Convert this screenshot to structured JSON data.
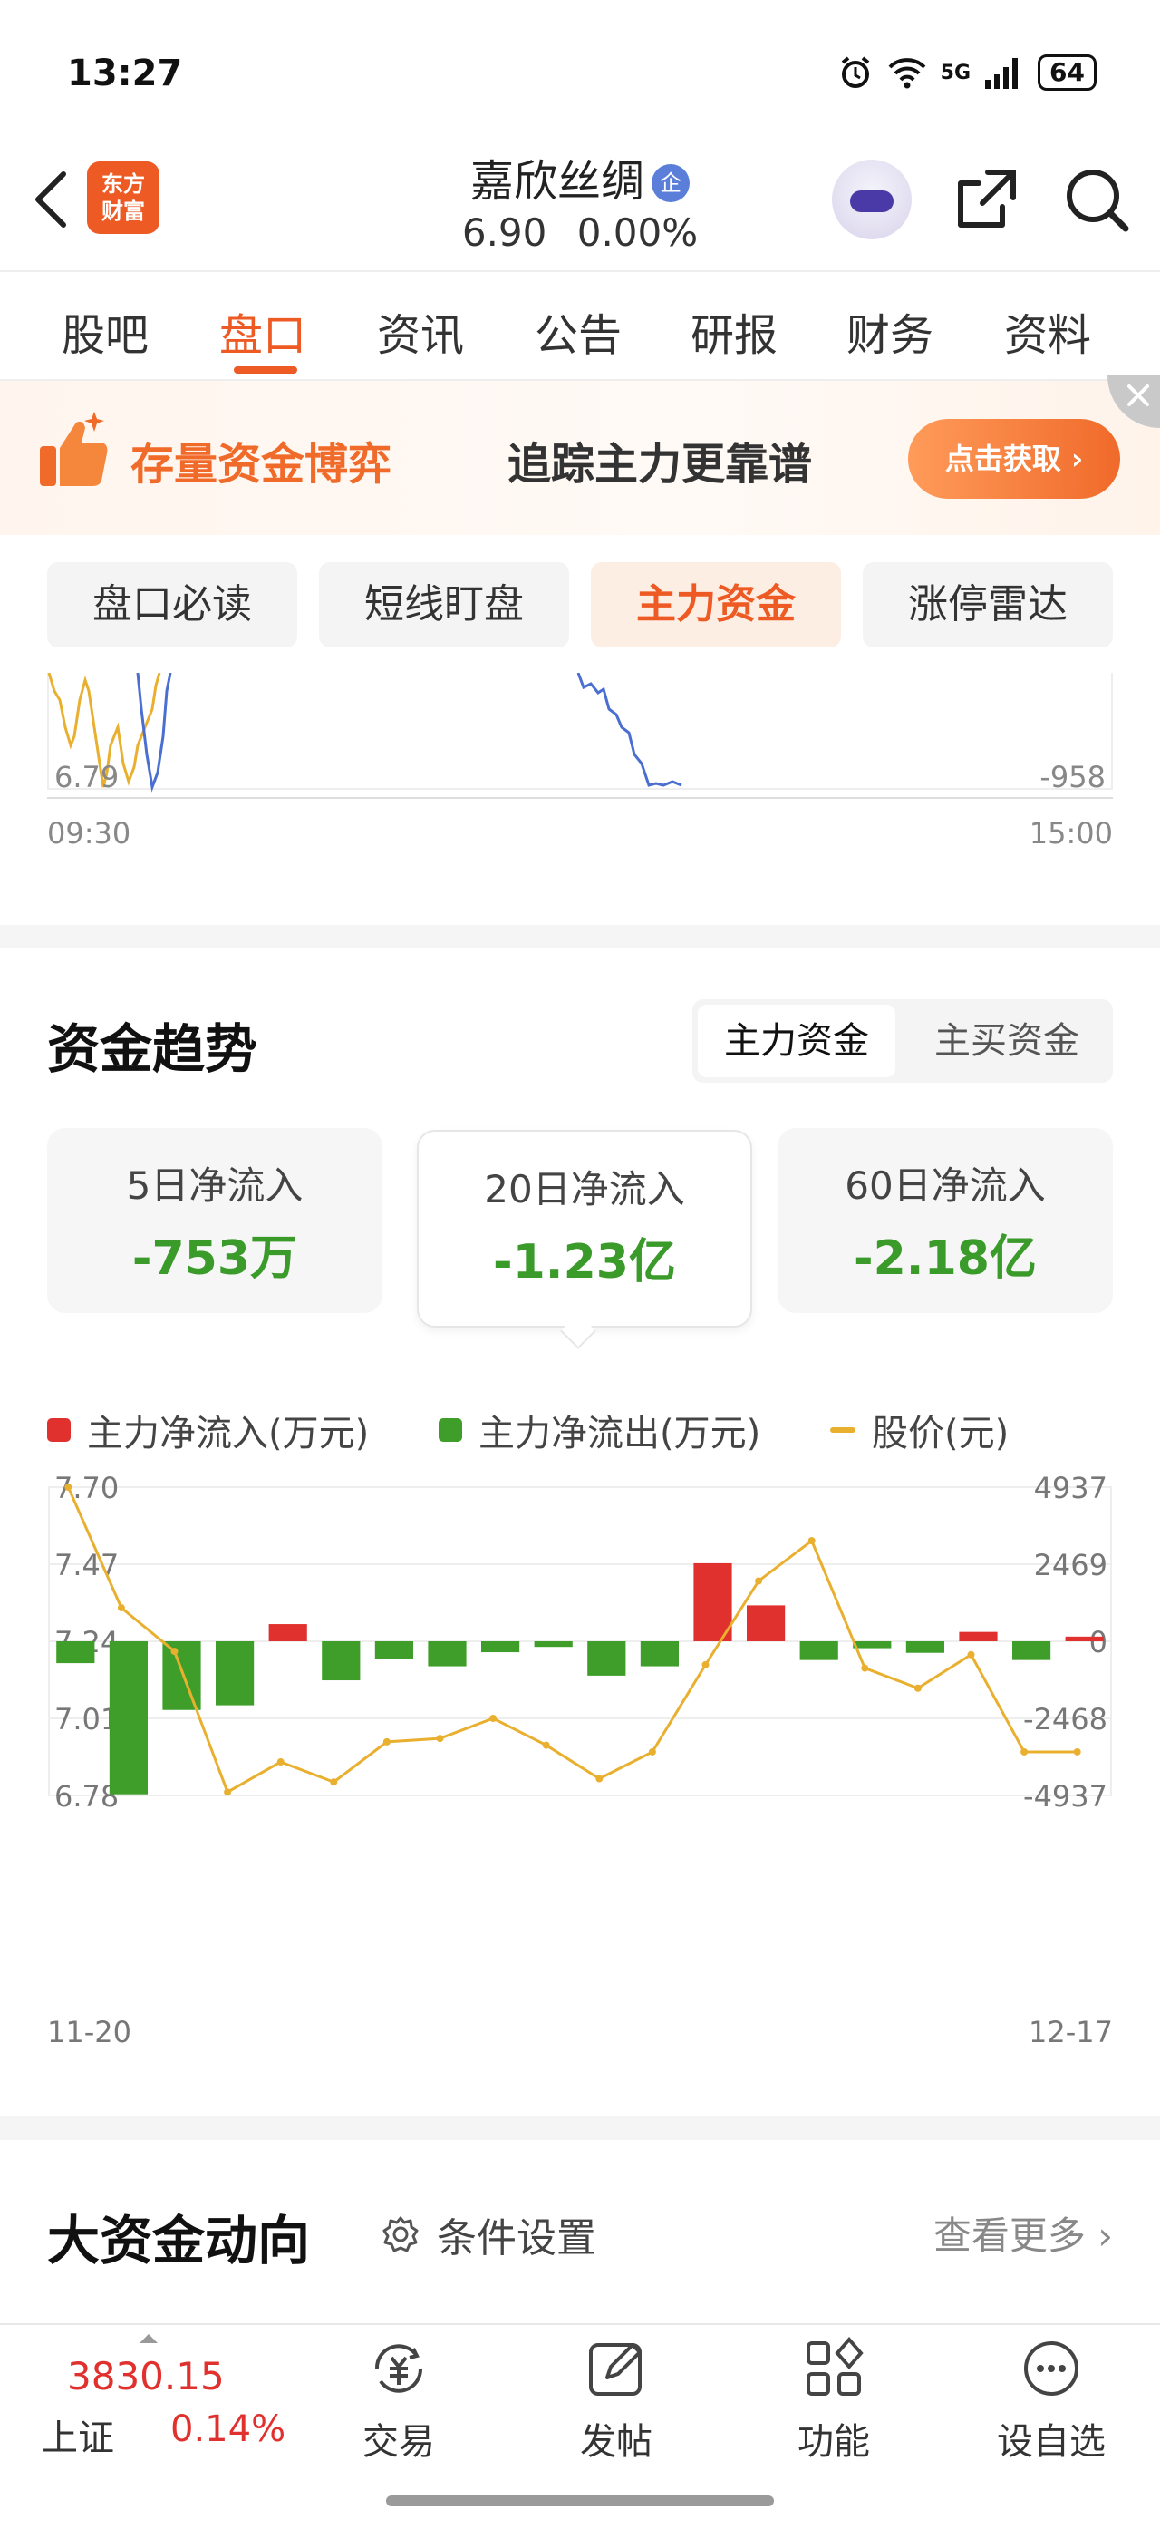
{
  "status_bar": {
    "time": "13:27",
    "network": "5G",
    "battery": "64"
  },
  "header": {
    "logo_text": "东方财富",
    "stock_name": "嘉欣丝绸",
    "badge": "企",
    "price": "6.90",
    "change_pct": "0.00%"
  },
  "tabs": [
    "股吧",
    "盘口",
    "资讯",
    "公告",
    "研报",
    "财务",
    "资料"
  ],
  "active_tab": "盘口",
  "banner": {
    "title": "存量资金博弈",
    "subtitle": "追踪主力更靠谱",
    "button": "点击获取"
  },
  "sub_tabs": [
    "盘口必读",
    "短线盯盘",
    "主力资金",
    "涨停雷达"
  ],
  "active_sub_tab": "主力资金",
  "intraday_chart": {
    "left_min_label": "6.79",
    "right_min_label": "-958",
    "time_start": "09:30",
    "time_end": "15:00"
  },
  "fund_trend": {
    "title": "资金趋势",
    "toggle": [
      "主力资金",
      "主买资金"
    ],
    "active_toggle": "主力资金",
    "cards": [
      {
        "label": "5日净流入",
        "value": "-753万"
      },
      {
        "label": "20日净流入",
        "value": "-1.23亿"
      },
      {
        "label": "60日净流入",
        "value": "-2.18亿"
      }
    ],
    "selected_card": "20日净流入"
  },
  "legend": {
    "inflow": "主力净流入(万元)",
    "outflow": "主力净流出(万元)",
    "price": "股价(元)"
  },
  "colors": {
    "accent": "#ee5a24",
    "inflow": "#e0312e",
    "outflow": "#3f9e2a",
    "price": "#e9b030",
    "blue_line": "#4a6fd1"
  },
  "chart_data": {
    "type": "bar",
    "x_start_label": "11-20",
    "x_end_label": "12-17",
    "left_axis_ticks": [
      "7.70",
      "7.47",
      "7.24",
      "7.01",
      "6.78"
    ],
    "right_axis_ticks": [
      "4937",
      "2469",
      "0",
      "-2468",
      "-4937"
    ],
    "ylim_flow": [
      -4937,
      4937
    ],
    "ylim_price": [
      6.78,
      7.7
    ],
    "series": [
      {
        "name": "主力净流入(万元)",
        "values": [
          -700,
          -4900,
          -2200,
          -2050,
          550,
          -1250,
          -580,
          -800,
          -350,
          -180,
          -1100,
          -800,
          2500,
          1150,
          -600,
          -220,
          -370,
          300,
          -600,
          150
        ]
      },
      {
        "name": "股价(元)",
        "values": [
          7.7,
          7.34,
          7.21,
          6.79,
          6.88,
          6.82,
          6.94,
          6.95,
          7.01,
          6.93,
          6.83,
          6.91,
          7.17,
          7.42,
          7.54,
          7.16,
          7.1,
          7.2,
          6.91,
          6.91
        ]
      }
    ],
    "grid": true
  },
  "big_fund": {
    "title": "大资金动向",
    "condition": "条件设置",
    "more": "查看更多"
  },
  "bottom_nav": {
    "index_value": "3830.15",
    "index_name": "上证",
    "index_pct": "0.14%",
    "items": [
      "交易",
      "发帖",
      "功能",
      "设自选"
    ]
  }
}
